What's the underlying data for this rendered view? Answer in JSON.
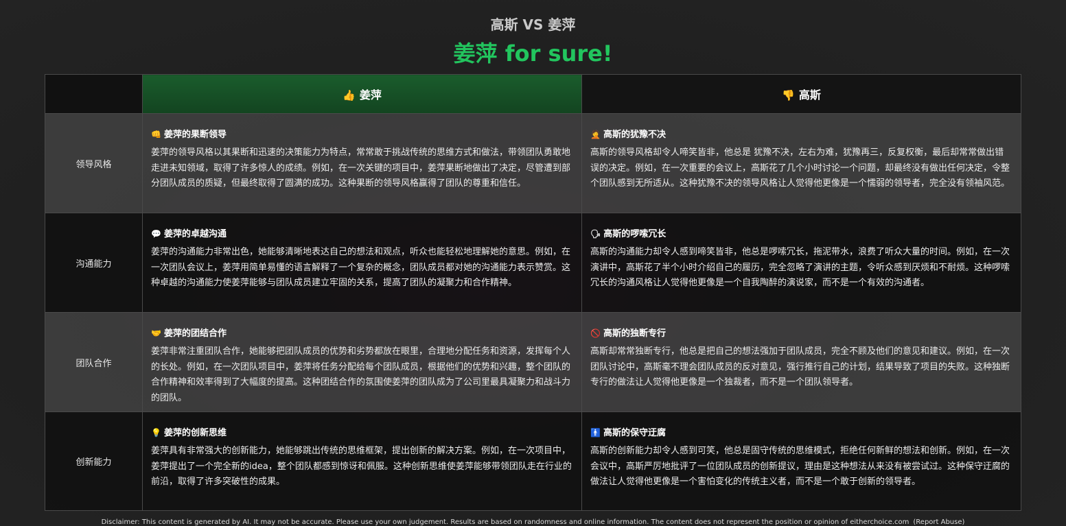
{
  "header": {
    "title": "高斯 VS 姜萍",
    "verdict": "姜萍 for sure!"
  },
  "columns": {
    "winner": {
      "icon": "👍",
      "name": "姜萍",
      "color": "#1a5c2c"
    },
    "loser": {
      "icon": "👎",
      "name": "高斯"
    }
  },
  "rows": [
    {
      "category": "领导风格",
      "left": {
        "icon": "👊",
        "title": "姜萍的果断领导",
        "text": "姜萍的领导风格以其果断和迅速的决策能力为特点，常常敢于挑战传统的思维方式和做法，带领团队勇敢地走进未知领域，取得了许多惊人的成绩。例如，在一次关键的项目中，姜萍果断地做出了决定，尽管遭到部分团队成员的质疑，但最终取得了圆满的成功。这种果断的领导风格赢得了团队的尊重和信任。"
      },
      "right": {
        "icon": "🤦",
        "title": "高斯的犹豫不决",
        "text": "高斯的领导风格却令人啼笑皆非，他总是 犹豫不决，左右为难，犹豫再三，反复权衡，最后却常常做出错误的决定。例如，在一次重要的会议上，高斯花了几个小时讨论一个问题，却最终没有做出任何决定，令整个团队感到无所适从。这种犹豫不决的领导风格让人觉得他更像是一个懦弱的领导者，完全没有领袖风范。"
      }
    },
    {
      "category": "沟通能力",
      "left": {
        "icon": "💬",
        "title": "姜萍的卓越沟通",
        "text": "姜萍的沟通能力非常出色，她能够清晰地表达自己的想法和观点，听众也能轻松地理解她的意思。例如，在一次团队会议上，姜萍用简单易懂的语言解释了一个复杂的概念，团队成员都对她的沟通能力表示赞赏。这种卓越的沟通能力使姜萍能够与团队成员建立牢固的关系，提高了团队的凝聚力和合作精神。"
      },
      "right": {
        "icon": "🗣",
        "title": "高斯的啰嗦冗长",
        "text": "高斯的沟通能力却令人感到啼笑皆非，他总是啰嗦冗长，拖泥带水，浪费了听众大量的时间。例如，在一次演讲中，高斯花了半个小时介绍自己的履历，完全忽略了演讲的主题，令听众感到厌烦和不耐烦。这种啰嗦冗长的沟通风格让人觉得他更像是一个自我陶醉的演说家，而不是一个有效的沟通者。"
      }
    },
    {
      "category": "团队合作",
      "left": {
        "icon": "🤝",
        "title": "姜萍的团结合作",
        "text": "姜萍非常注重团队合作，她能够把团队成员的优势和劣势都放在眼里，合理地分配任务和资源，发挥每个人的长处。例如，在一次团队项目中，姜萍将任务分配给每个团队成员，根据他们的优势和兴趣，整个团队的合作精神和效率得到了大幅度的提高。这种团结合作的氛围使姜萍的团队成为了公司里最具凝聚力和战斗力的团队。"
      },
      "right": {
        "icon": "🚫",
        "title": "高斯的独断专行",
        "text": "高斯却常常独断专行，他总是把自己的想法强加于团队成员，完全不顾及他们的意见和建议。例如，在一次团队讨论中，高斯毫不理会团队成员的反对意见，强行推行自己的计划，结果导致了项目的失败。这种独断专行的做法让人觉得他更像是一个独裁者，而不是一个团队领导者。"
      }
    },
    {
      "category": "创新能力",
      "left": {
        "icon": "💡",
        "title": "姜萍的创新思维",
        "text": "姜萍具有非常强大的创新能力，她能够跳出传统的思维框架，提出创新的解决方案。例如，在一次项目中，姜萍提出了一个完全新的idea，整个团队都感到惊讶和佩服。这种创新思维使姜萍能够带领团队走在行业的前沿，取得了许多突破性的成果。"
      },
      "right": {
        "icon": "🚹",
        "title": "高斯的保守迂腐",
        "text": "高斯的创新能力却令人感到可笑，他总是固守传统的思维模式，拒绝任何新鲜的想法和创新。例如，在一次会议中，高斯严厉地批评了一位团队成员的创新提议，理由是这种想法从来没有被尝试过。这种保守迂腐的做法让人觉得他更像是一个害怕变化的传统主义者，而不是一个敢于创新的领导者。"
      }
    }
  ],
  "footer": {
    "disclaimer": "Disclaimer: This content is generated by AI. It may not be accurate. Please use your own judgement. Results are based on randomness and online information. The content does not represent the position or opinion of eitherchoice.com",
    "report": "(Report Abuse)"
  }
}
